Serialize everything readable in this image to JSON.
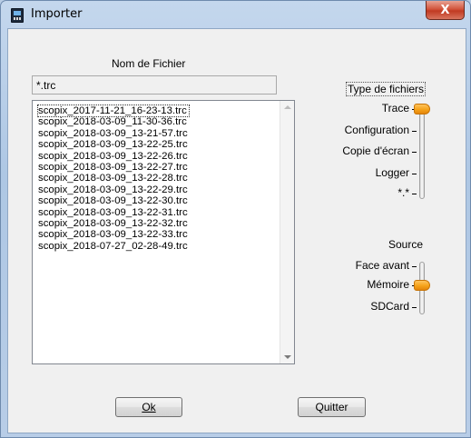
{
  "window": {
    "title": "Importer",
    "close_label": "X"
  },
  "file": {
    "name_label": "Nom de Fichier",
    "filter_value": "*.trc",
    "items": [
      "scopix_2017-11-21_16-23-13.trc",
      "scopix_2018-03-09_11-30-36.trc",
      "scopix_2018-03-09_13-21-57.trc",
      "scopix_2018-03-09_13-22-25.trc",
      "scopix_2018-03-09_13-22-26.trc",
      "scopix_2018-03-09_13-22-27.trc",
      "scopix_2018-03-09_13-22-28.trc",
      "scopix_2018-03-09_13-22-29.trc",
      "scopix_2018-03-09_13-22-30.trc",
      "scopix_2018-03-09_13-22-31.trc",
      "scopix_2018-03-09_13-22-32.trc",
      "scopix_2018-03-09_13-22-33.trc",
      "scopix_2018-07-27_02-28-49.trc"
    ],
    "selected_index": 0
  },
  "type_group": {
    "title": "Type de fichiers",
    "options": [
      "Trace",
      "Configuration",
      "Copie d'écran",
      "Logger",
      "*.*"
    ],
    "selected": "Trace"
  },
  "source_group": {
    "title": "Source",
    "options": [
      "Face avant",
      "Mémoire",
      "SDCard"
    ],
    "selected": "Mémoire"
  },
  "buttons": {
    "ok": "Ok",
    "quit": "Quitter"
  },
  "colors": {
    "slider_thumb": "#f5a21a",
    "close_button": "#c7432b",
    "title_bar": "#b9cde5"
  }
}
